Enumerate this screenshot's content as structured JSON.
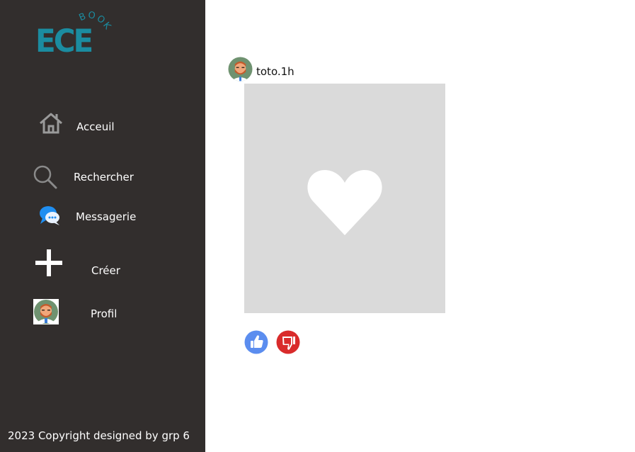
{
  "brand": {
    "logo_main": "ECE",
    "logo_sup": "BOOK",
    "logo_color": "#1b8ca0"
  },
  "sidebar": {
    "background": "#322e2d",
    "items": [
      {
        "label": "Acceuil",
        "icon": "home-icon"
      },
      {
        "label": "Rechercher",
        "icon": "search-icon"
      },
      {
        "label": "Messagerie",
        "icon": "chat-bubble-icon"
      },
      {
        "label": "Créer",
        "icon": "plus-icon"
      },
      {
        "label": "Profil",
        "icon": "avatar-icon"
      }
    ],
    "footer": "2023 Copyright designed by grp 6"
  },
  "post": {
    "author": "toto.1h",
    "author_avatar": "avatar-icon",
    "image_icon": "heart-icon",
    "actions": [
      {
        "name": "like",
        "icon": "thumbs-up-icon",
        "color": "#5b8def"
      },
      {
        "name": "dislike",
        "icon": "thumbs-down-icon",
        "color": "#d92b2b"
      }
    ]
  }
}
